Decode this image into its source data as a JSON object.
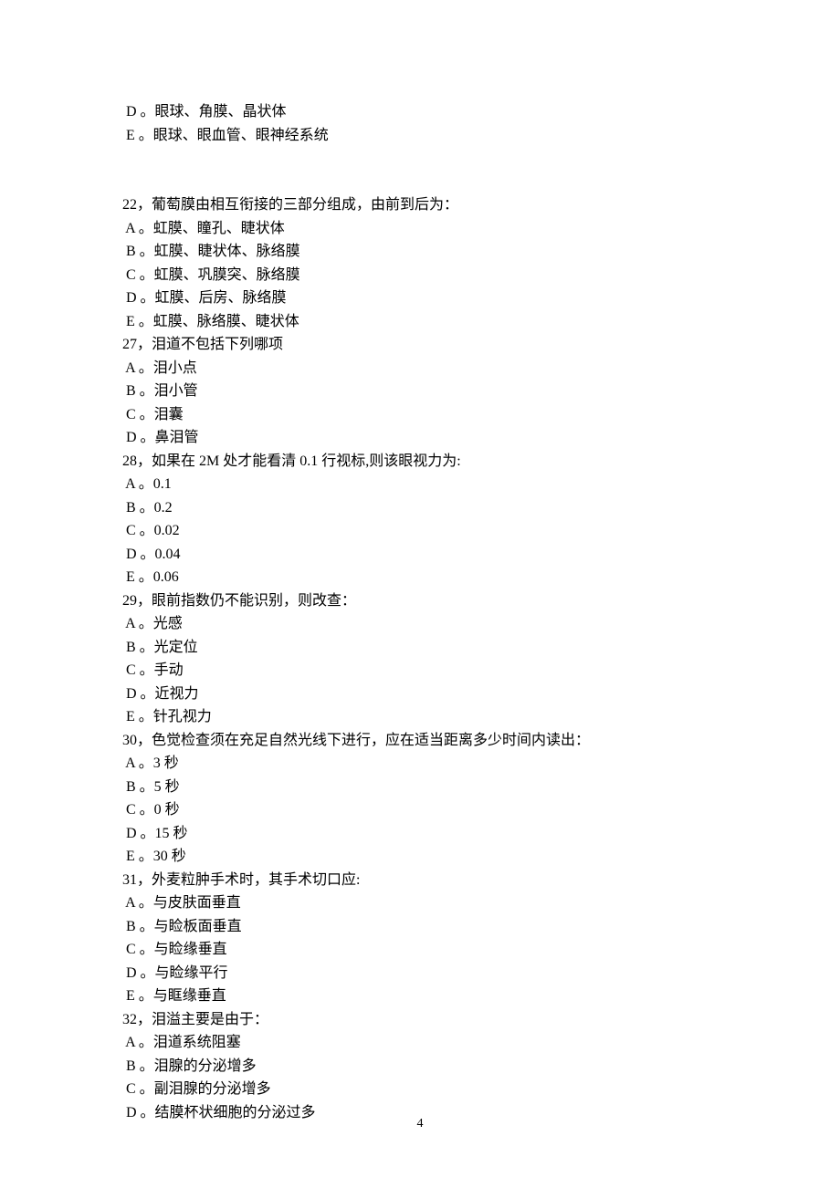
{
  "page_number": "4",
  "lines": [
    " D 。眼球、角膜、晶状体",
    " E 。眼球、眼血管、眼神经系统",
    "",
    "",
    "22，葡萄膜由相互衔接的三部分组成，由前到后为：",
    " A 。虹膜、瞳孔、睫状体",
    " B 。虹膜、睫状体、脉络膜",
    " C 。虹膜、巩膜突、脉络膜",
    " D 。虹膜、后房、脉络膜",
    " E 。虹膜、脉络膜、睫状体",
    "27，泪道不包括下列哪项",
    " A 。泪小点",
    " B 。泪小管",
    " C 。泪囊",
    " D 。鼻泪管",
    "28，如果在 2M 处才能看清 0.1 行视标,则该眼视力为:",
    " A 。0.1",
    " B 。0.2",
    " C 。0.02",
    " D 。0.04",
    " E 。0.06",
    "29，眼前指数仍不能识别，则改查：",
    " A 。光感",
    " B 。光定位",
    " C 。手动",
    " D 。近视力",
    " E 。针孔视力",
    "30，色觉检查须在充足自然光线下进行，应在适当距离多少时间内读出：",
    " A 。3 秒",
    " B 。5 秒",
    " C 。0 秒",
    " D 。15 秒",
    " E 。30 秒",
    "31，外麦粒肿手术时，其手术切口应:",
    " A 。与皮肤面垂直",
    " B 。与睑板面垂直",
    " C 。与睑缘垂直",
    " D 。与睑缘平行",
    " E 。与眶缘垂直",
    "32，泪溢主要是由于：",
    " A 。泪道系统阻塞",
    " B 。泪腺的分泌增多",
    " C 。副泪腺的分泌增多",
    " D 。结膜杯状细胞的分泌过多"
  ]
}
